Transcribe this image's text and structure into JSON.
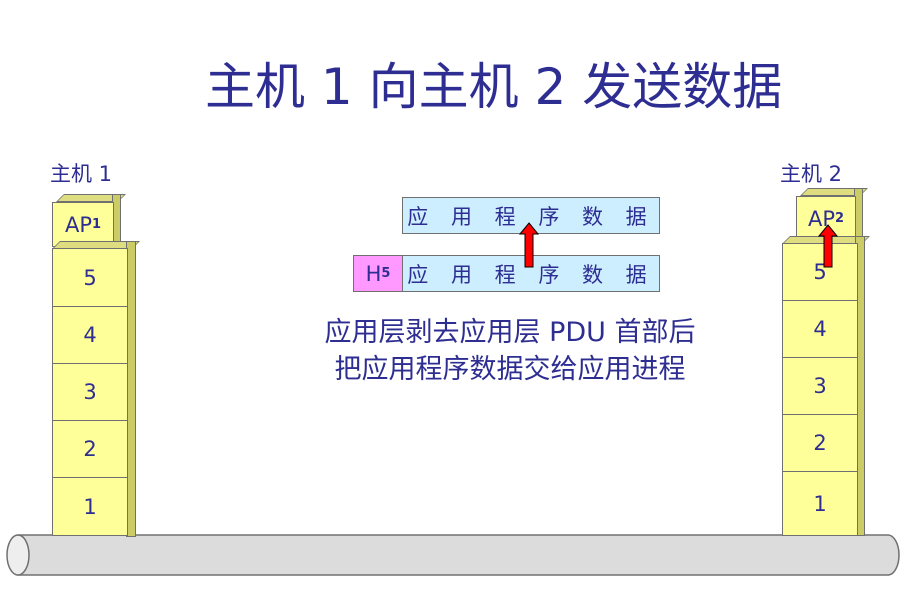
{
  "title": "主机 1 向主机 2 发送数据",
  "host1": {
    "label": "主机 1",
    "ap": {
      "text": "AP",
      "sub": "1"
    },
    "layers": [
      "5",
      "4",
      "3",
      "2",
      "1"
    ]
  },
  "host2": {
    "label": "主机 2",
    "ap": {
      "text": "AP",
      "sub": "2"
    },
    "layers": [
      "5",
      "4",
      "3",
      "2",
      "1"
    ]
  },
  "pdu_top": {
    "text": "应 用 程 序 数 据"
  },
  "pdu_bottom": {
    "header": {
      "text": "H",
      "sub": "5"
    },
    "text": "应 用 程 序 数 据"
  },
  "caption": {
    "line1": "应用层剥去应用层 PDU 首部后",
    "line2": "把应用程序数据交给应用进程"
  },
  "colors": {
    "layer_fill": "#ffff99",
    "pdu_fill": "#cceeff",
    "header_fill": "#ff99ff",
    "arrow": "#ff0000",
    "text": "#2e2e92"
  }
}
